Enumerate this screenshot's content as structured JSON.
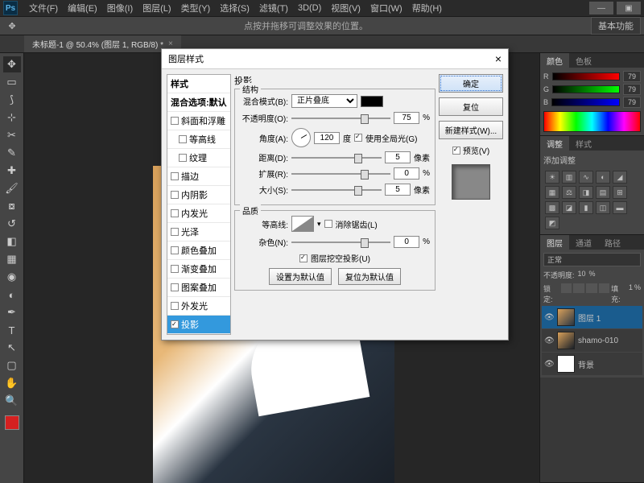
{
  "app": {
    "logo": "Ps"
  },
  "menu": {
    "items": [
      "文件(F)",
      "编辑(E)",
      "图像(I)",
      "图层(L)",
      "类型(Y)",
      "选择(S)",
      "滤镜(T)",
      "3D(D)",
      "视图(V)",
      "窗口(W)",
      "帮助(H)"
    ]
  },
  "optbar": {
    "hint": "点按并拖移可调整效果的位置。",
    "right": "基本功能"
  },
  "doctab": {
    "title": "未标题-1 @ 50.4% (图层 1, RGB/8) *",
    "close": "×"
  },
  "panels": {
    "color": {
      "tabs": [
        "颜色",
        "色板"
      ],
      "r": "R",
      "g": "G",
      "b": "B",
      "rv": "79",
      "gv": "79",
      "bv": "79"
    },
    "adjust": {
      "tabs": [
        "调整",
        "样式"
      ],
      "title": "添加调整"
    },
    "layers": {
      "tabs": [
        "图层",
        "通道",
        "路径"
      ],
      "blend": "正常",
      "opacity_lbl": "不透明度:",
      "opacity": "10",
      "pct": "%",
      "lock_lbl": "锁定:",
      "fill_lbl": "填充:",
      "fill": "1",
      "fill_pct": "%",
      "items": [
        {
          "name": "图层 1"
        },
        {
          "name": "shamo-010"
        },
        {
          "name": "背景"
        }
      ]
    }
  },
  "dialog": {
    "title": "图层样式",
    "styles": {
      "hdr": "样式",
      "blend_default": "混合选项:默认",
      "list": [
        "斜面和浮雕",
        "等高线",
        "纹理",
        "描边",
        "内阴影",
        "内发光",
        "光泽",
        "颜色叠加",
        "渐变叠加",
        "图案叠加",
        "外发光",
        "投影"
      ]
    },
    "section": "投影",
    "struct": {
      "title": "结构",
      "blend_mode_lbl": "混合模式(B):",
      "blend_mode": "正片叠底",
      "opacity_lbl": "不透明度(O):",
      "opacity": "75",
      "pct": "%",
      "angle_lbl": "角度(A):",
      "angle": "120",
      "deg": "度",
      "global": "使用全局光(G)",
      "dist_lbl": "距离(D):",
      "dist": "5",
      "px": "像素",
      "spread_lbl": "扩展(R):",
      "spread": "0",
      "size_lbl": "大小(S):",
      "size": "5"
    },
    "quality": {
      "title": "品质",
      "contour_lbl": "等高线:",
      "anti": "消除锯齿(L)",
      "noise_lbl": "杂色(N):",
      "noise": "0",
      "knockout": "图层挖空投影(U)"
    },
    "btns": {
      "defset": "设置为默认值",
      "defreset": "复位为默认值"
    },
    "right": {
      "ok": "确定",
      "cancel": "复位",
      "newstyle": "新建样式(W)...",
      "preview": "预览(V)"
    }
  }
}
